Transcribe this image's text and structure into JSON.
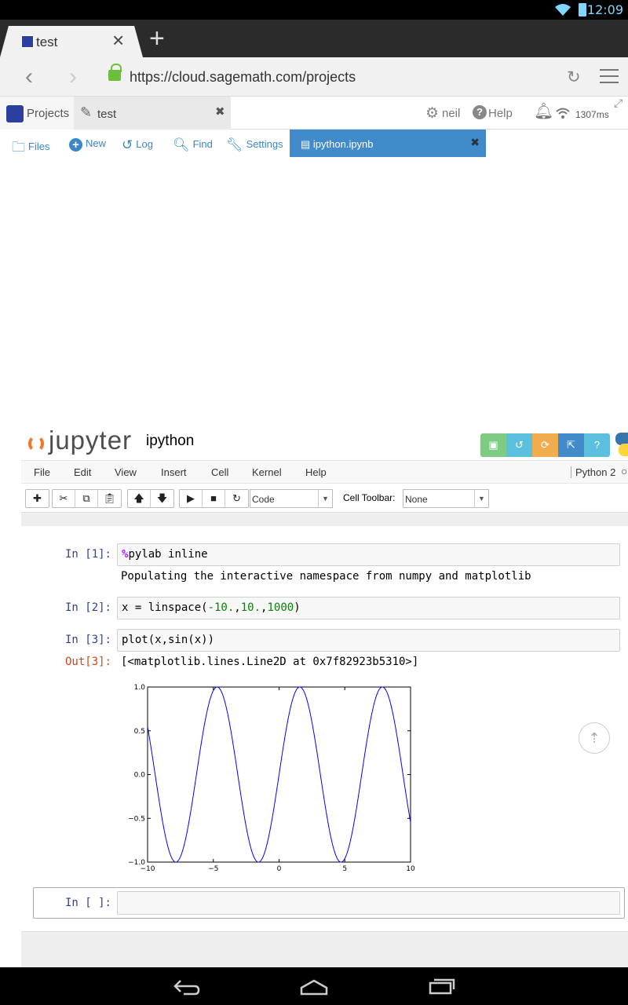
{
  "status_bar": {
    "time": "12:09"
  },
  "browser": {
    "tab_title": "test",
    "url": "https://cloud.sagemath.com/projects"
  },
  "smc": {
    "projects_label": "Projects",
    "project_tab": "test",
    "user": "neil",
    "help": "Help",
    "ping": "1307ms",
    "toolbar": {
      "files": "Files",
      "new": "New",
      "log": "Log",
      "find": "Find",
      "settings": "Settings"
    },
    "open_file": "ipython.ipynb"
  },
  "jupyter": {
    "logo_text": "jupyter",
    "notebook_name": "ipython",
    "header_button_colors": [
      "#7ecc84",
      "#5bc0de",
      "#f0ad4e",
      "#428bca",
      "#5bc0de"
    ],
    "menu": [
      "File",
      "Edit",
      "View",
      "Insert",
      "Cell",
      "Kernel",
      "Help"
    ],
    "kernel": "Python 2",
    "cell_type": "Code",
    "cell_toolbar_label": "Cell Toolbar:",
    "cell_toolbar_value": "None"
  },
  "cells": {
    "c1": {
      "prompt": "In [1]:",
      "code_magic": "%",
      "code_rest": "pylab inline",
      "output": "Populating the interactive namespace from numpy and matplotlib"
    },
    "c2": {
      "prompt": "In [2]:",
      "code_a": "x = linspace(",
      "num1": "-10.",
      "code_b": ",",
      "num2": "10.",
      "code_c": ",",
      "num3": "1000",
      "code_d": ")"
    },
    "c3": {
      "prompt": "In [3]:",
      "code": "plot(x,sin(x))",
      "out_prompt": "Out[3]:",
      "output": "[<matplotlib.lines.Line2D at 0x7f82923b5310>]"
    },
    "c4": {
      "prompt": "In [ ]:"
    }
  },
  "chart_data": {
    "type": "line",
    "function": "sin(x)",
    "xlim": [
      -10,
      10
    ],
    "ylim": [
      -1.0,
      1.0
    ],
    "x_ticks": [
      "−10",
      "−5",
      "0",
      "5",
      "10"
    ],
    "y_ticks": [
      "1.0",
      "0.5",
      "0.0",
      "−0.5",
      "−1.0"
    ],
    "x_tick_values": [
      -10,
      -5,
      0,
      5,
      10
    ],
    "y_tick_values": [
      1.0,
      0.5,
      0.0,
      -0.5,
      -1.0
    ],
    "line_color": "#0000ff",
    "num_points": 1000,
    "grid": false
  }
}
